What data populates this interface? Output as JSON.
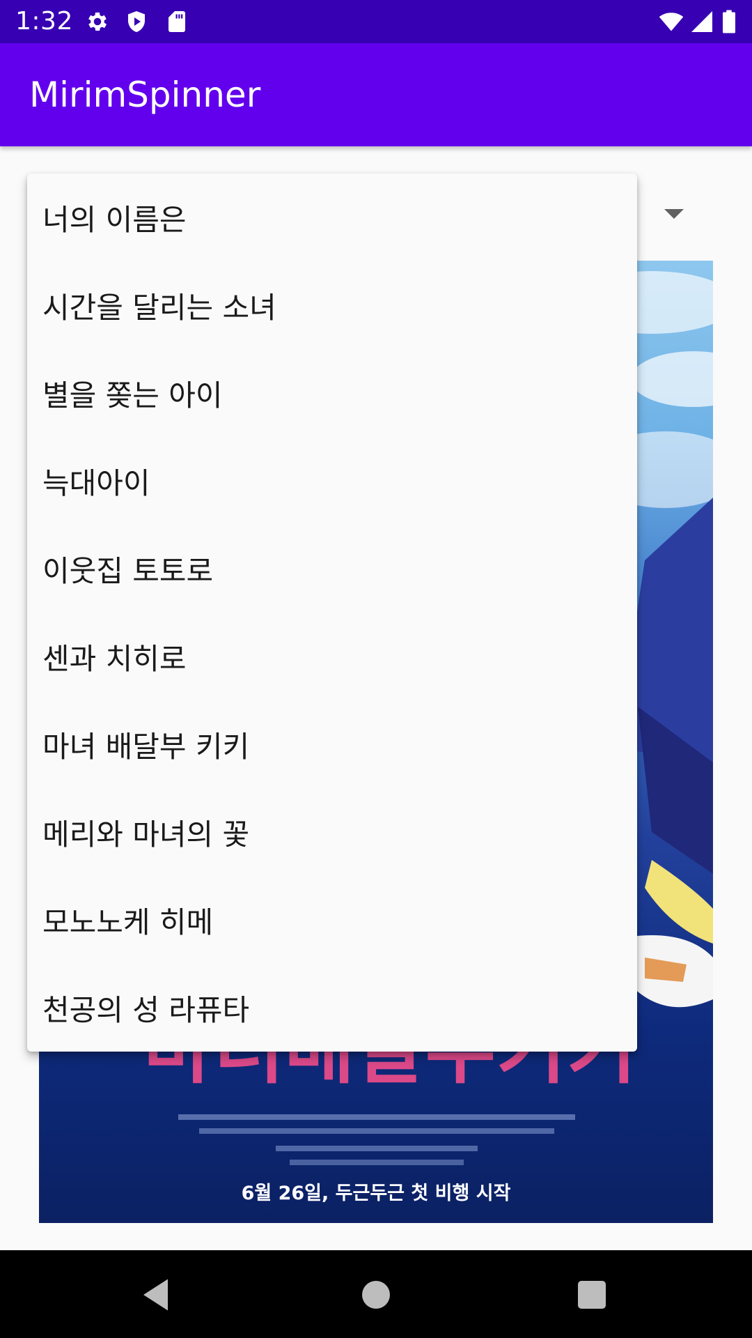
{
  "status_bar": {
    "time": "1:32",
    "icons_left": [
      "gear-icon",
      "shield-play-icon",
      "sd-card-icon"
    ],
    "icons_right": [
      "wifi-icon",
      "cellular-signal-icon",
      "battery-icon"
    ],
    "background": "#3700b3"
  },
  "app_bar": {
    "title": "MirimSpinner",
    "background": "#6200ee"
  },
  "spinner": {
    "arrow_icon": "dropdown-arrow-icon",
    "items": [
      "너의 이름은",
      "시간을 달리는 소녀",
      "별을 쫒는 아이",
      "늑대아이",
      "이웃집 토토로",
      "센과 치히로",
      "마녀 배달부 키키",
      "메리와 마녀의 꽃",
      "모노노케 히메",
      "천공의 성 라퓨타"
    ]
  },
  "poster": {
    "bottom_text": "6월 26일, 두근두근 첫 비행 시작"
  },
  "nav_bar": {
    "back": "back-icon",
    "home": "home-icon",
    "recents": "recents-icon"
  }
}
